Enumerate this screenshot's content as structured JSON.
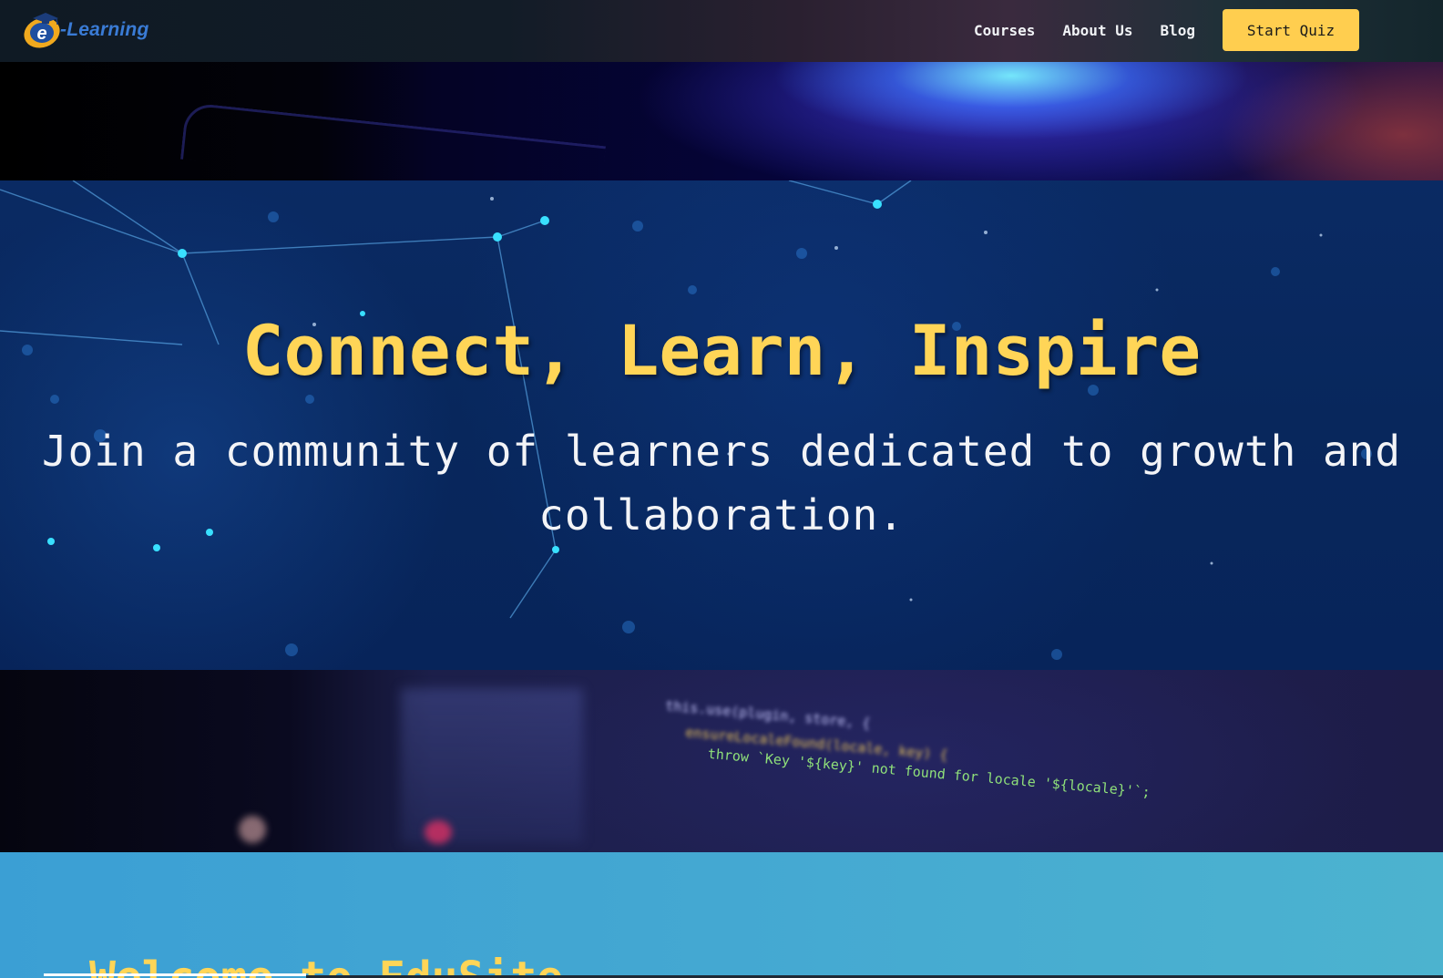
{
  "brand": {
    "logo_text": "-Learning",
    "logo_letter": "e"
  },
  "nav": {
    "links": [
      "Courses",
      "About Us",
      "Blog"
    ],
    "cta": "Start Quiz"
  },
  "hero": {
    "title": "Connect, Learn, Inspire",
    "subtitle_line1": "Join a community of learners dedicated to growth and",
    "subtitle_line2": "collaboration."
  },
  "code_snippet": {
    "line1": "this.use(plugin, store, {",
    "line2": "ensureLocaleFound(locale, key) {",
    "line3": "throw `Key '${key}' not found for locale '${locale}'`;"
  },
  "welcome": {
    "title": "Welcome to EduSite"
  },
  "colors": {
    "accent": "#ffd557",
    "button": "#ffce4f",
    "hero_bg": "#08275c",
    "welcome_bg": "#44a8d2",
    "logo_blue": "#3a7bd5"
  }
}
